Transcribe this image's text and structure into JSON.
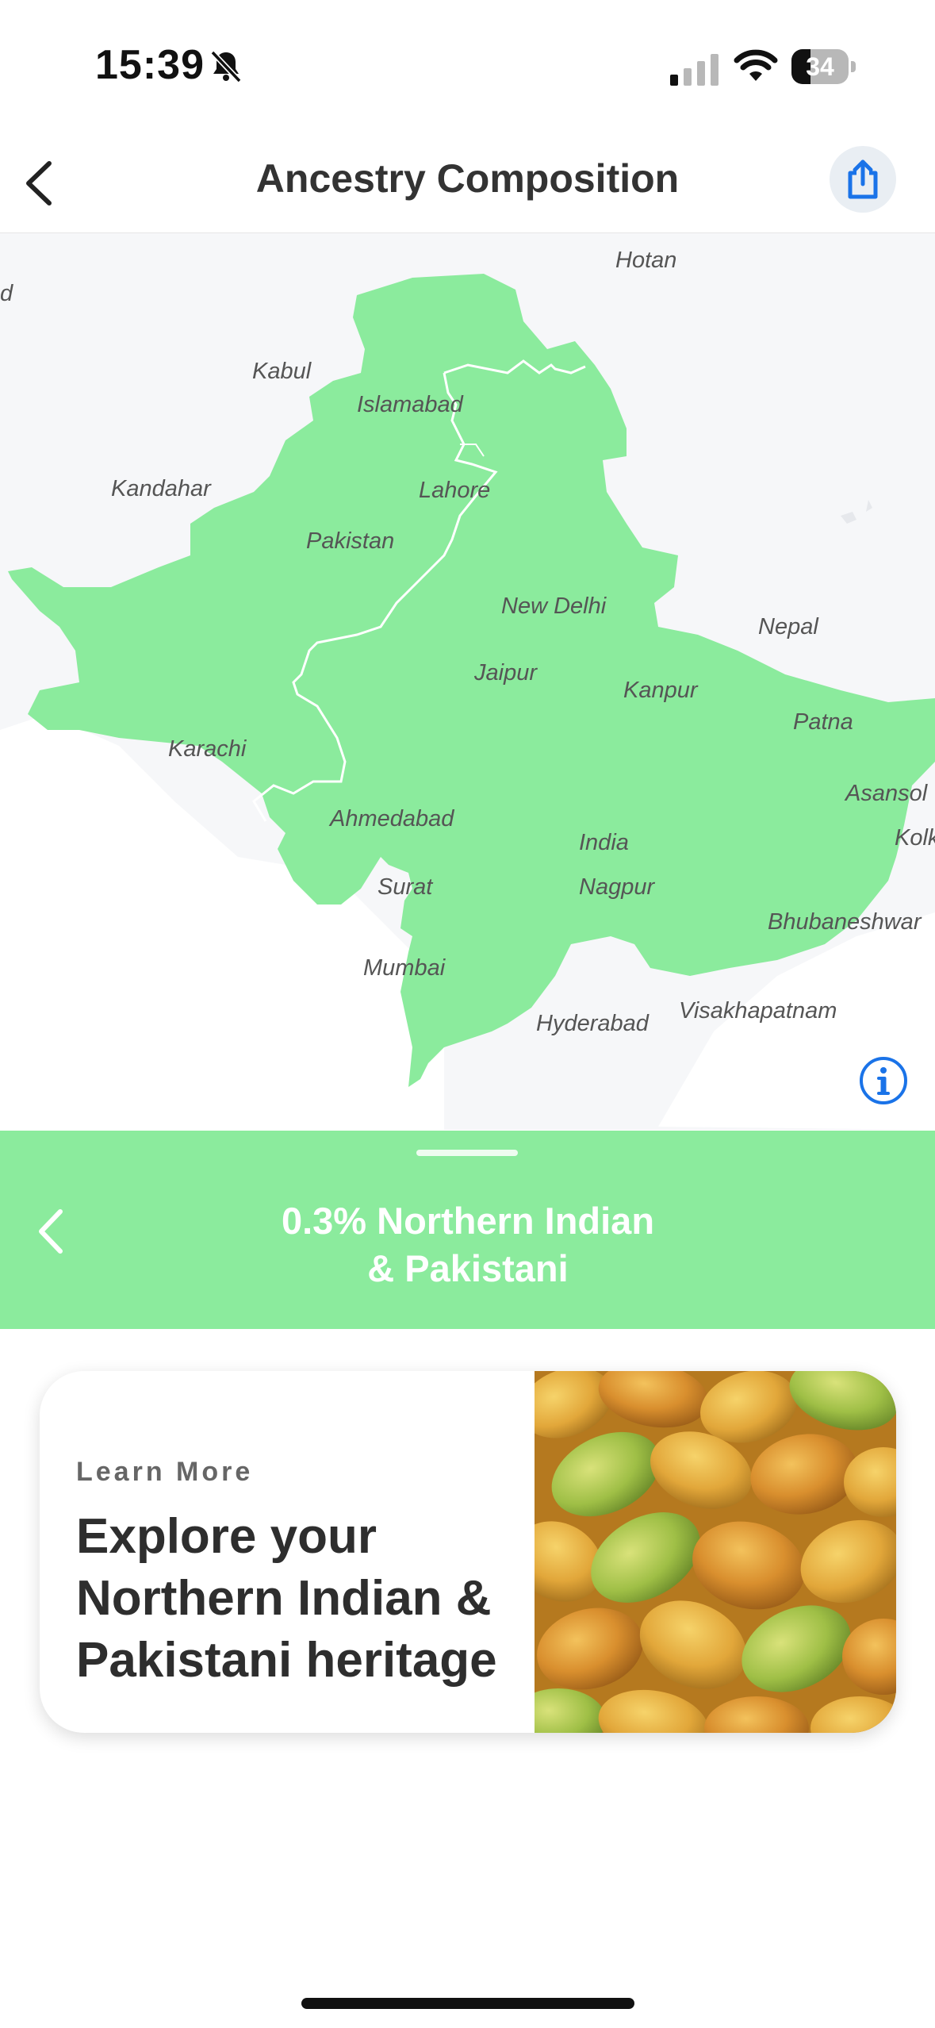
{
  "status_bar": {
    "time": "15:39",
    "battery_level": "34",
    "battery_fraction": 0.34,
    "icons": [
      "bell-slash-icon",
      "cellular-signal-icon",
      "wifi-icon",
      "battery-icon"
    ]
  },
  "header": {
    "title": "Ancestry Composition",
    "back_icon": "chevron-left-icon",
    "share_icon": "share-icon"
  },
  "map": {
    "highlight_color": "#8beb9d",
    "cities": {
      "hotan": "Hotan",
      "kabul": "Kabul",
      "islamabad": "Islamabad",
      "kandahar": "Kandahar",
      "lahore": "Lahore",
      "pakistan": "Pakistan",
      "new_delhi": "New Delhi",
      "nepal": "Nepal",
      "jaipur": "Jaipur",
      "kanpur": "Kanpur",
      "patna": "Patna",
      "karachi": "Karachi",
      "asansol": "Asansol",
      "kolkata": "Kolk",
      "ahmedabad": "Ahmedabad",
      "india": "India",
      "surat": "Surat",
      "nagpur": "Nagpur",
      "bhubaneswar": "Bhubaneshwar",
      "mumbai": "Mumbai",
      "visakhapatnam": "Visakhapatnam",
      "hyderabad": "Hyderabad",
      "edge_fragment": "d"
    },
    "info_icon": "info-circle-icon"
  },
  "region_panel": {
    "title_line1": "0.3% Northern Indian",
    "title_line2": "& Pakistani",
    "back_icon": "chevron-left-icon"
  },
  "learn_card": {
    "eyebrow": "Learn More",
    "heading": "Explore your Northern Indian & Pakistani heritage",
    "image": "mangoes-photo"
  },
  "colors": {
    "accent_green": "#8beb9d",
    "link_blue": "#1a73e8"
  }
}
